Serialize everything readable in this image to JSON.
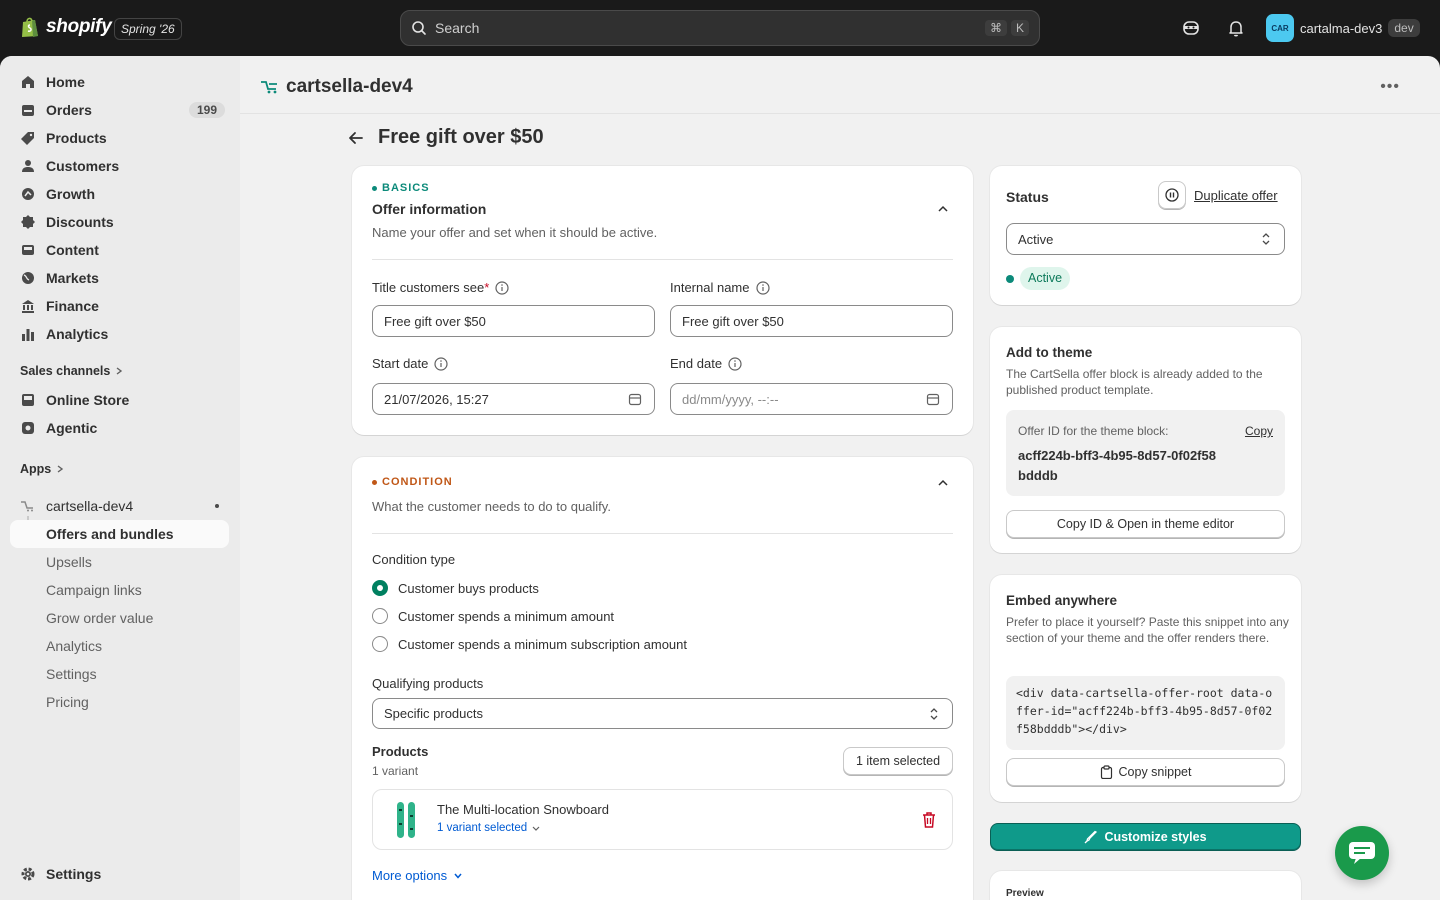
{
  "brand": {
    "name": "shopify",
    "season": "Spring '26"
  },
  "search": {
    "placeholder": "Search",
    "shortcut_mod": "⌘",
    "shortcut_key": "K"
  },
  "user": {
    "initials": "CAR",
    "store": "cartalma-dev3",
    "badge": "dev"
  },
  "sidebar": {
    "items": [
      {
        "label": "Home",
        "icon": "home-icon"
      },
      {
        "label": "Orders",
        "icon": "orders-icon",
        "count": "199"
      },
      {
        "label": "Products",
        "icon": "tag-icon"
      },
      {
        "label": "Customers",
        "icon": "person-icon"
      },
      {
        "label": "Growth",
        "icon": "growth-icon"
      },
      {
        "label": "Discounts",
        "icon": "discount-icon"
      },
      {
        "label": "Content",
        "icon": "content-icon"
      },
      {
        "label": "Markets",
        "icon": "globe-icon"
      },
      {
        "label": "Finance",
        "icon": "bank-icon"
      },
      {
        "label": "Analytics",
        "icon": "chart-icon"
      }
    ],
    "sales_channels_label": "Sales channels",
    "channels": [
      {
        "label": "Online Store",
        "icon": "store-icon"
      },
      {
        "label": "Agentic",
        "icon": "agentic-icon"
      }
    ],
    "apps_label": "Apps",
    "app": {
      "name": "cartsella-dev4",
      "subitems": [
        "Offers and bundles",
        "Upsells",
        "Campaign links",
        "Grow order value",
        "Analytics",
        "Settings",
        "Pricing"
      ]
    },
    "settings_label": "Settings"
  },
  "app_header": {
    "title": "cartsella-dev4"
  },
  "page": {
    "title": "Free gift over $50"
  },
  "basics": {
    "eyebrow": "BASICS",
    "title": "Offer information",
    "description": "Name your offer and set when it should be active.",
    "title_label": "Title customers see",
    "required_mark": "*",
    "title_value": "Free gift over $50",
    "internal_label": "Internal name",
    "internal_value": "Free gift over $50",
    "start_label": "Start date",
    "start_value": "21/07/2026, 15:27",
    "end_label": "End date",
    "end_placeholder": "dd/mm/yyyy, --:--"
  },
  "condition": {
    "eyebrow": "CONDITION",
    "description": "What the customer needs to do to qualify.",
    "type_label": "Condition type",
    "options": [
      "Customer buys products",
      "Customer spends a minimum amount",
      "Customer spends a minimum subscription amount"
    ],
    "selected_index": 0,
    "qualifying_label": "Qualifying products",
    "qualifying_value": "Specific products",
    "products_label": "Products",
    "products_sub": "1 variant",
    "selected_button": "1 item selected",
    "product_name": "The Multi-location Snowboard",
    "variant_link": "1 variant selected",
    "more_options": "More options"
  },
  "status": {
    "title": "Status",
    "duplicate": "Duplicate offer",
    "select_value": "Active",
    "badge": "Active"
  },
  "theme": {
    "title": "Add to theme",
    "description": "The CartSella offer block is already added to the published product template.",
    "id_label": "Offer ID for the theme block:",
    "copy": "Copy",
    "offer_id": "acff224b-bff3-4b95-8d57-0f02f58bdddb",
    "button": "Copy ID & Open in theme editor"
  },
  "embed": {
    "title": "Embed anywhere",
    "description": "Prefer to place it yourself? Paste this snippet into any section of your theme and the offer renders there.",
    "snippet": "<div data-cartsella-offer-root data-offer-id=\"acff224b-bff3-4b95-8d57-0f02f58bdddb\"></div>",
    "button": "Copy snippet"
  },
  "customize": {
    "button": "Customize styles"
  },
  "preview": {
    "label": "Preview"
  },
  "colors": {
    "accent": "#008060",
    "teal_button": "#0f9a8a",
    "orange": "#c05717",
    "teal": "#0c8a7a",
    "chat": "#1a9a4b"
  }
}
